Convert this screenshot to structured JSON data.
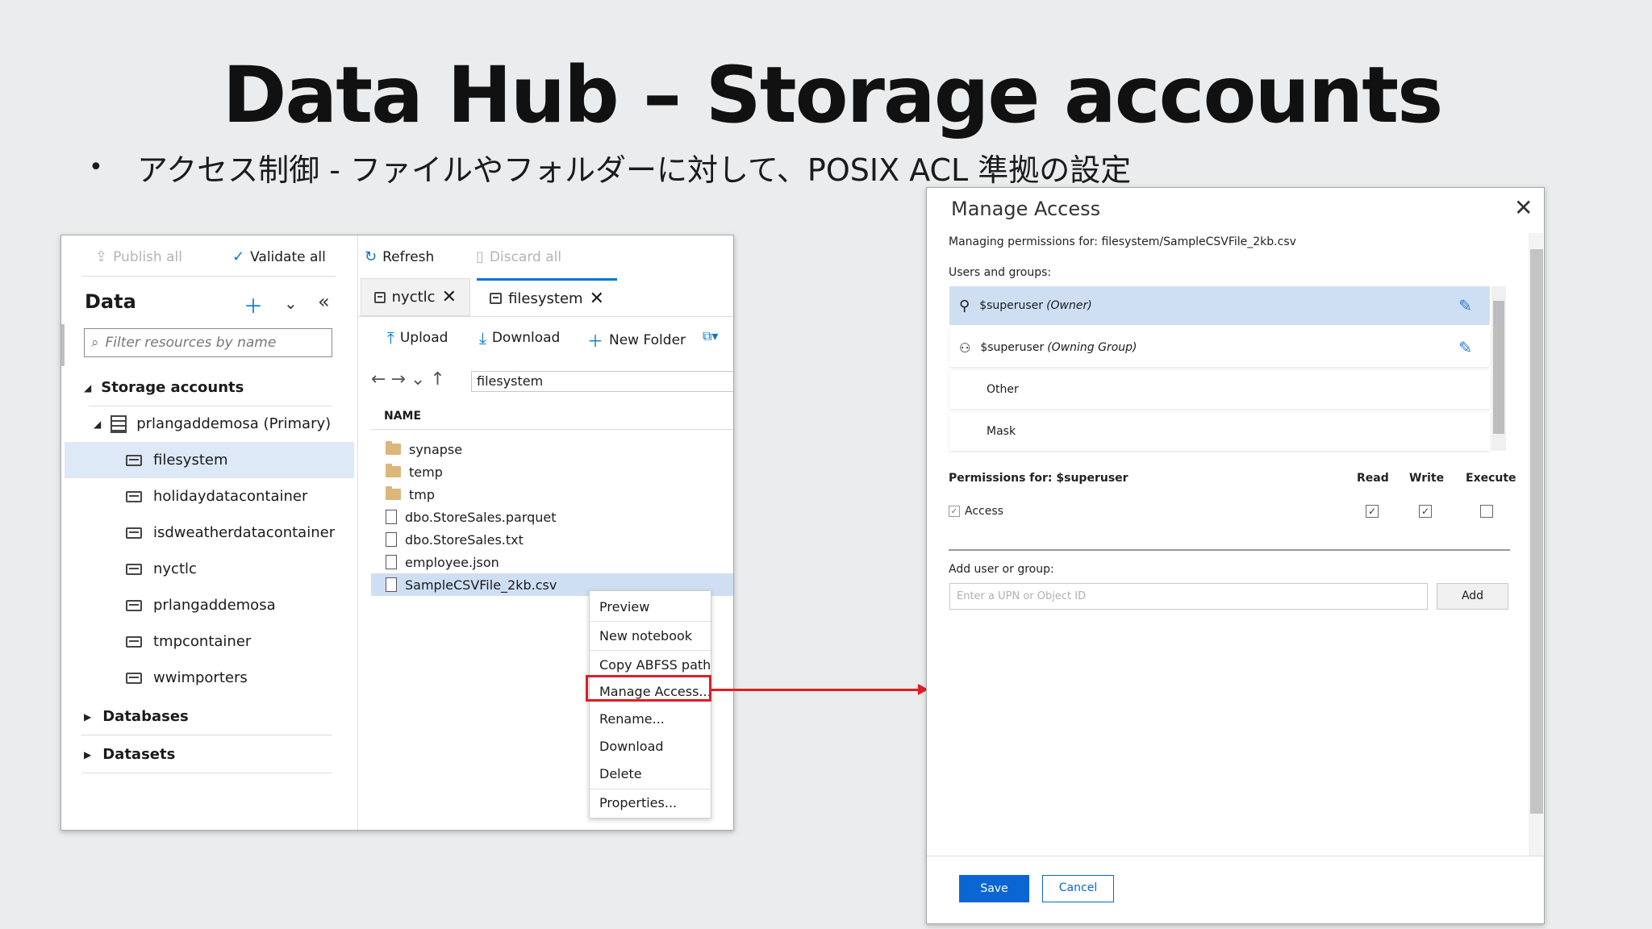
{
  "slide": {
    "title": "Data Hub – Storage accounts",
    "bullet": "アクセス制御 - ファイルやフォルダーに対して、POSIX ACL 準拠の設定"
  },
  "toolbar": {
    "publish_all": "Publish all",
    "validate_all": "Validate all",
    "refresh": "Refresh",
    "discard_all": "Discard all"
  },
  "data_pane": {
    "title": "Data",
    "filter_placeholder": "Filter resources by name",
    "storage_accounts": "Storage accounts",
    "account": "prlangaddemosa (Primary)",
    "containers": [
      "filesystem",
      "holidaydatacontainer",
      "isdweatherdatacontainer",
      "nyctlc",
      "prlangaddemosa",
      "tmpcontainer",
      "wwimporters"
    ],
    "databases": "Databases",
    "datasets": "Datasets"
  },
  "tabs": [
    {
      "label": "nyctlc"
    },
    {
      "label": "filesystem"
    }
  ],
  "file_toolbar": {
    "upload": "Upload",
    "download": "Download",
    "new_folder": "New Folder"
  },
  "browser": {
    "path": "filesystem",
    "column_name": "NAME",
    "files": [
      {
        "name": "synapse",
        "type": "folder"
      },
      {
        "name": "temp",
        "type": "folder"
      },
      {
        "name": "tmp",
        "type": "folder"
      },
      {
        "name": "dbo.StoreSales.parquet",
        "type": "file"
      },
      {
        "name": "dbo.StoreSales.txt",
        "type": "file"
      },
      {
        "name": "employee.json",
        "type": "file"
      },
      {
        "name": "SampleCSVFile_2kb.csv",
        "type": "file"
      }
    ]
  },
  "context_menu": [
    "Preview",
    "New notebook",
    "Copy ABFSS path",
    "Manage Access...",
    "Rename...",
    "Download",
    "Delete",
    "Properties..."
  ],
  "manage_access": {
    "title": "Manage Access",
    "managing_for": "Managing permissions for: filesystem/SampleCSVFile_2kb.csv",
    "users_groups_label": "Users and groups:",
    "entries": [
      {
        "name": "$superuser",
        "role": "(Owner)"
      },
      {
        "name": "$superuser",
        "role": "(Owning Group)"
      },
      {
        "name": "Other",
        "role": ""
      },
      {
        "name": "Mask",
        "role": ""
      }
    ],
    "permissions_for": "Permissions for: $superuser",
    "col_read": "Read",
    "col_write": "Write",
    "col_execute": "Execute",
    "access_label": "Access",
    "add_user_label": "Add user or group:",
    "upn_placeholder": "Enter a UPN or Object ID",
    "add_button": "Add",
    "save_button": "Save",
    "cancel_button": "Cancel"
  },
  "colors": {
    "accent": "#0078d4",
    "highlight": "#e01d24",
    "selection": "#dde9f7"
  }
}
